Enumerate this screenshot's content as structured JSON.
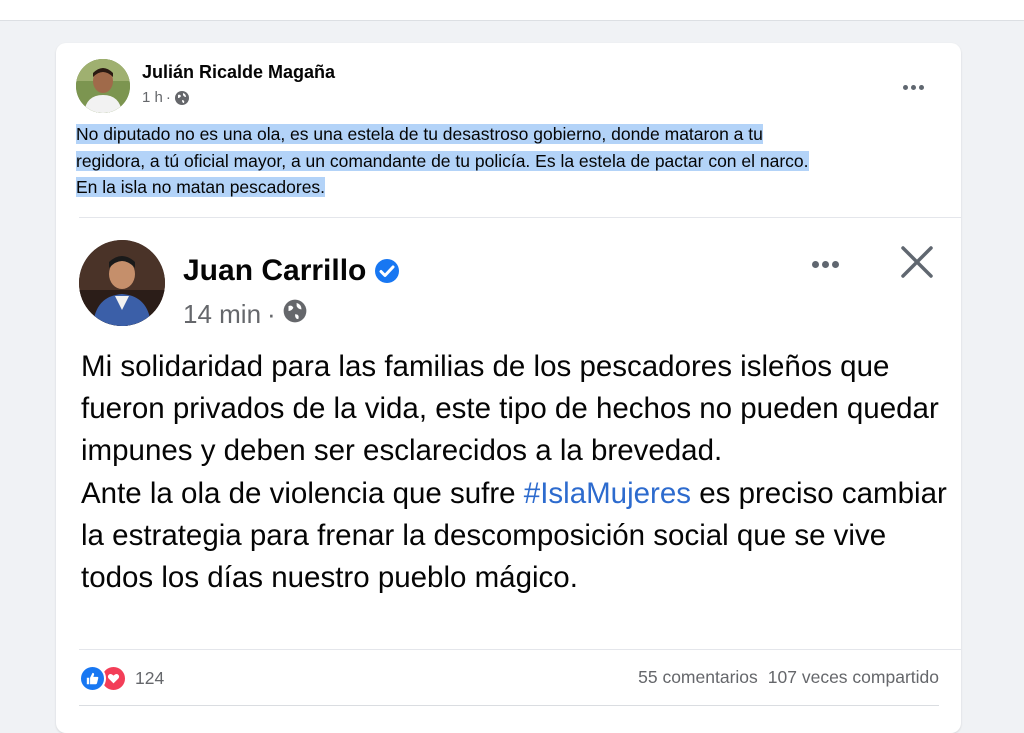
{
  "post": {
    "author": "Julián Ricalde Magaña",
    "time": "1 h",
    "separator": "·",
    "text_lines": [
      "No diputado no es una ola, es una estela de tu desastroso gobierno, donde mataron a tu",
      "regidora, a tú oficial mayor, a un comandante de tu policía. Es la estela de pactar con el narco.",
      "En la isla no matan pescadores."
    ]
  },
  "shared": {
    "author": "Juan Carrillo",
    "time": "14 min",
    "separator": "·",
    "paragraph1": "Mi solidaridad para las familias de los pescadores isleños que fueron privados de la vida, este tipo de hechos no pueden quedar impunes y deben ser esclarecidos a la brevedad.",
    "paragraph2_before": "Ante la ola de violencia que sufre ",
    "hashtag": "#IslaMujeres",
    "paragraph2_after": " es preciso cambiar la estrategia para frenar la descomposición social que se vive todos los días nuestro pueblo mágico."
  },
  "footer": {
    "reaction_count": "124",
    "comments": "55 comentarios",
    "shares": "107 veces compartido"
  },
  "colors": {
    "highlight": "#b3d3f8",
    "hashtag": "#2d6bce",
    "like": "#1877f2",
    "love": "#f33e58",
    "verified": "#1877f2"
  }
}
